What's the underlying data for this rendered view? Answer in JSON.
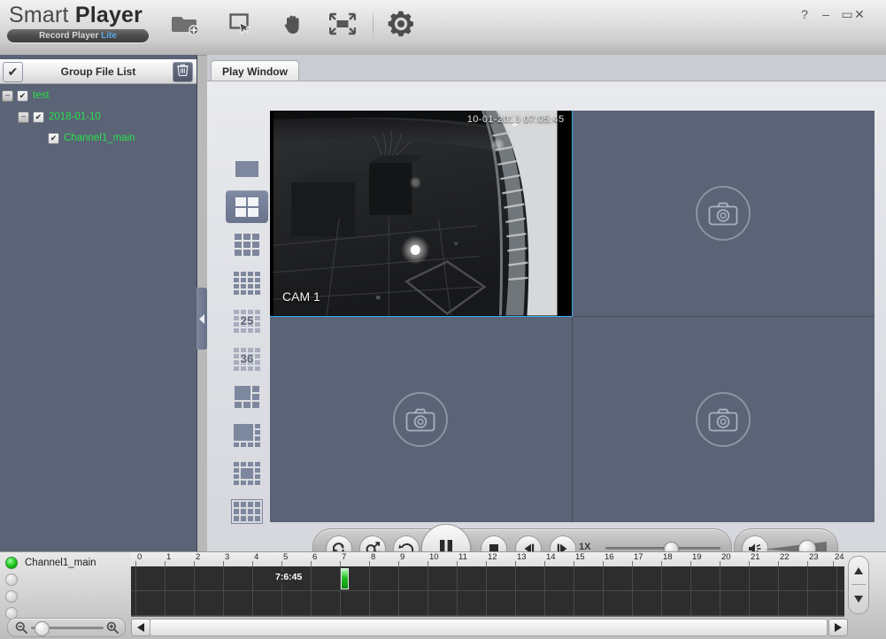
{
  "window": {
    "logo_light": "Smart ",
    "logo_bold": "Player",
    "badge_text": "Record Player ",
    "badge_lite": "Lite",
    "help_label": "?",
    "minimize_label": "–",
    "maximize_label": "▭",
    "close_label": "✕"
  },
  "toolbar": {
    "buttons": [
      {
        "name": "open-folder-icon",
        "title": "Open File"
      },
      {
        "name": "select-tool-icon",
        "title": "Select"
      },
      {
        "name": "hand-tool-icon",
        "title": "Pan"
      },
      {
        "name": "fit-window-icon",
        "title": "Fit Window"
      },
      {
        "name": "settings-gear-icon",
        "title": "Settings"
      }
    ]
  },
  "sidebar": {
    "title": "Group File List",
    "check_glyph": "✔",
    "trash_icon": "trash-icon",
    "tree": [
      {
        "label": "test",
        "expander": "–",
        "checked": "✔",
        "indent": 2
      },
      {
        "label": "2018-01-10",
        "expander": "–",
        "checked": "✔",
        "indent": 20
      },
      {
        "label": "Channel1_main",
        "expander": "",
        "checked": "✔",
        "indent": 38
      }
    ],
    "collapse_glyph": "◀"
  },
  "main": {
    "tab_label": "Play Window",
    "layouts": [
      {
        "name": "layout-1",
        "cols": 1,
        "rows": 1,
        "label": "",
        "selected": false
      },
      {
        "name": "layout-4",
        "cols": 2,
        "rows": 2,
        "label": "",
        "selected": true
      },
      {
        "name": "layout-9",
        "cols": 3,
        "rows": 3,
        "label": "",
        "selected": false
      },
      {
        "name": "layout-16",
        "cols": 4,
        "rows": 4,
        "label": "",
        "selected": false
      },
      {
        "name": "layout-25",
        "cols": 4,
        "rows": 4,
        "label": "25",
        "selected": false
      },
      {
        "name": "layout-36",
        "cols": 4,
        "rows": 4,
        "label": "36",
        "selected": false
      },
      {
        "name": "layout-6-split",
        "cols": 3,
        "rows": 3,
        "label": "",
        "selected": false
      },
      {
        "name": "layout-8-split",
        "cols": 4,
        "rows": 3,
        "label": "",
        "selected": false
      },
      {
        "name": "layout-13-split",
        "cols": 4,
        "rows": 4,
        "label": "",
        "selected": false
      },
      {
        "name": "layout-custom",
        "cols": 4,
        "rows": 3,
        "label": "",
        "selected": false
      }
    ],
    "cells": [
      {
        "name": "video-cell-1",
        "active": true,
        "has_video": true,
        "timestamp": "10-01-2018 07:05:45",
        "camera_label": "CAM 1"
      },
      {
        "name": "video-cell-2",
        "active": false,
        "has_video": false,
        "timestamp": "",
        "camera_label": ""
      },
      {
        "name": "video-cell-3",
        "active": false,
        "has_video": false,
        "timestamp": "",
        "camera_label": ""
      },
      {
        "name": "video-cell-4",
        "active": false,
        "has_video": false,
        "timestamp": "",
        "camera_label": ""
      }
    ]
  },
  "transport": {
    "speed_label": "1X",
    "buttons": [
      {
        "name": "loop-button",
        "title": "Loop"
      },
      {
        "name": "shuffle-button",
        "title": "Shuffle"
      },
      {
        "name": "rewind-button",
        "title": "Rewind"
      },
      {
        "name": "pause-button",
        "title": "Pause"
      },
      {
        "name": "stop-button",
        "title": "Stop"
      },
      {
        "name": "step-back-button",
        "title": "Previous Frame"
      },
      {
        "name": "step-forward-button",
        "title": "Next Frame"
      }
    ],
    "speed_slider_percent": 50,
    "volume_icon": "speaker-icon",
    "volume_percent": 62
  },
  "timeline": {
    "channels": [
      {
        "label": "Channel1_main",
        "on": true
      },
      {
        "label": "",
        "on": false
      },
      {
        "label": "",
        "on": false
      },
      {
        "label": "",
        "on": false
      }
    ],
    "ticks": [
      "0",
      "1",
      "2",
      "3",
      "4",
      "5",
      "6",
      "7",
      "8",
      "9",
      "10",
      "11",
      "12",
      "13",
      "14",
      "15",
      "16",
      "17",
      "18",
      "19",
      "20",
      "21",
      "22",
      "23",
      "24"
    ],
    "current_time_label": "7:6:45",
    "playhead_hour": 7.0,
    "zoom_out_icon": "zoom-out-icon",
    "zoom_in_icon": "zoom-in-icon",
    "zoom_percent": 8,
    "scroll_up_glyph": "▲",
    "scroll_down_glyph": "▼",
    "scroll_left_glyph": "◀",
    "scroll_right_glyph": "▶"
  },
  "colors": {
    "tree_green": "#27e24a",
    "accent_blue": "#3aa7ee",
    "panel_slate": "#5b6376",
    "playhead_green": "#22c222"
  }
}
